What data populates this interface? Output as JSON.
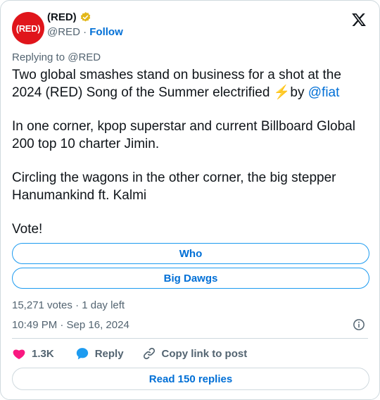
{
  "author": {
    "avatar_text": "(RED)",
    "name": "(RED)",
    "handle": "@RED",
    "separator": " · ",
    "follow_label": "Follow"
  },
  "replying_to": "Replying to @RED",
  "tweet": {
    "p1_a": "Two global smashes stand on business for a shot at the 2024 (RED) Song of the Summer electrified ",
    "p1_emoji": "⚡",
    "p1_b": "by ",
    "p1_mention": "@fiat",
    "p2": "In one corner, kpop superstar and current Billboard Global 200 top 10 charter Jimin.",
    "p3": "Circling the wagons in the other corner, the big stepper Hanumankind ft. Kalmi",
    "p4": "Vote!"
  },
  "poll": {
    "options": [
      "Who",
      "Big Dawgs"
    ],
    "summary": "15,271 votes · 1 day left"
  },
  "timestamp": "10:49 PM · Sep 16, 2024",
  "actions": {
    "likes": "1.3K",
    "reply_label": "Reply",
    "copy_label": "Copy link to post"
  },
  "read_replies_label": "Read 150 replies",
  "colors": {
    "brand_red": "#e0151b",
    "link_blue": "#006fd6",
    "poll_border": "#1d9bf0",
    "like_pink": "#f91880",
    "reply_blue": "#1d9bf0",
    "verified_gold": "#e2b719"
  }
}
